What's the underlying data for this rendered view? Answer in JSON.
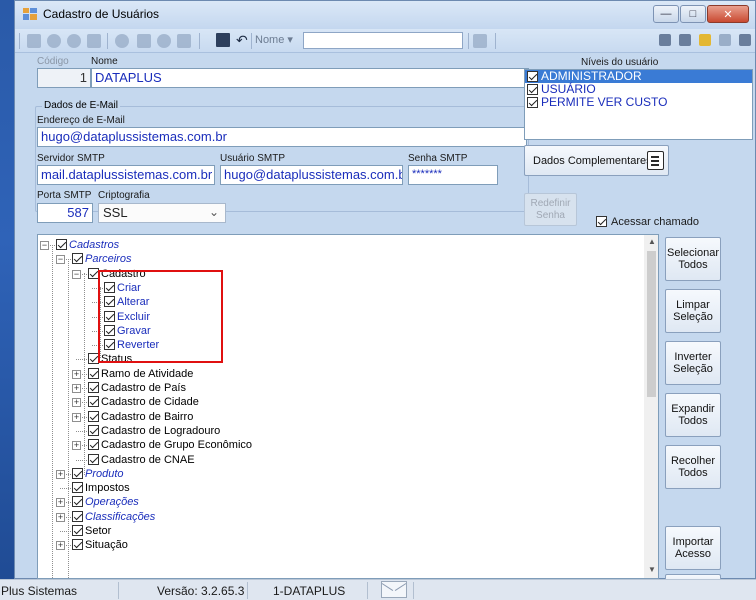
{
  "window": {
    "title": "Cadastro de Usuários",
    "controls": [
      "minimize",
      "maximize",
      "close"
    ]
  },
  "toolbar": {
    "nome_label": "Nome",
    "nome_value": ""
  },
  "form": {
    "codigo_label": "Código",
    "codigo_value": "1",
    "nome_label": "Nome",
    "nome_value": "DATAPLUS",
    "email_group_label": "Dados de E-Mail",
    "email_label": "Endereço de E-Mail",
    "email_value": "hugo@dataplussistemas.com.br",
    "smtp_server_label": "Servidor SMTP",
    "smtp_server_value": "mail.dataplussistemas.com.br",
    "smtp_user_label": "Usuário SMTP",
    "smtp_user_value": "hugo@dataplussistemas.com.br",
    "smtp_password_label": "Senha SMTP",
    "smtp_password_value": "*******",
    "smtp_port_label": "Porta SMTP",
    "smtp_port_value": "587",
    "crypto_label": "Criptografia",
    "crypto_value": "SSL"
  },
  "levels": {
    "label": "Níveis do usuário",
    "items": [
      {
        "label": "ADMINISTRADOR",
        "checked": true,
        "selected": true
      },
      {
        "label": "USUÁRIO",
        "checked": true,
        "selected": false
      },
      {
        "label": "PERMITE VER CUSTO",
        "checked": true,
        "selected": false
      }
    ]
  },
  "buttons": {
    "dados_complementares": "Dados Complementares",
    "redefinir_senha_1": "Redefinir",
    "redefinir_senha_2": "Senha",
    "acessar_chamado": "Acessar chamado",
    "selecionar_todos_1": "Selecionar",
    "selecionar_todos_2": "Todos",
    "limpar_selecao_1": "Limpar",
    "limpar_selecao_2": "Seleção",
    "inverter_selecao_1": "Inverter",
    "inverter_selecao_2": "Seleção",
    "expandir_todos_1": "Expandir",
    "expandir_todos_2": "Todos",
    "recolher_todos_1": "Recolher",
    "recolher_todos_2": "Todos",
    "importar_acesso_1": "Importar",
    "importar_acesso_2": "Acesso"
  },
  "tree": {
    "nodes": [
      {
        "label": "Cadastros",
        "style": "italic",
        "level": 0
      },
      {
        "label": "Parceiros",
        "style": "italic",
        "level": 1
      },
      {
        "label": "Cadastro",
        "style": "normal",
        "level": 2
      },
      {
        "label": "Criar",
        "style": "blue",
        "level": 3
      },
      {
        "label": "Alterar",
        "style": "blue",
        "level": 3
      },
      {
        "label": "Excluir",
        "style": "blue",
        "level": 3
      },
      {
        "label": "Gravar",
        "style": "blue",
        "level": 3
      },
      {
        "label": "Reverter",
        "style": "blue",
        "level": 3
      },
      {
        "label": "Status",
        "style": "normal",
        "level": 2
      },
      {
        "label": "Ramo de Atividade",
        "style": "normal",
        "level": 2
      },
      {
        "label": "Cadastro de País",
        "style": "normal",
        "level": 2
      },
      {
        "label": "Cadastro de Cidade",
        "style": "normal",
        "level": 2
      },
      {
        "label": "Cadastro de Bairro",
        "style": "normal",
        "level": 2
      },
      {
        "label": "Cadastro de Logradouro",
        "style": "normal",
        "level": 2
      },
      {
        "label": "Cadastro de Grupo Econômico",
        "style": "normal",
        "level": 2
      },
      {
        "label": "Cadastro de CNAE",
        "style": "normal",
        "level": 2
      },
      {
        "label": "Produto",
        "style": "italic",
        "level": 1
      },
      {
        "label": "Impostos",
        "style": "normal",
        "level": 1
      },
      {
        "label": "Operações",
        "style": "italic",
        "level": 1
      },
      {
        "label": "Classificações",
        "style": "italic",
        "level": 1
      },
      {
        "label": "Setor",
        "style": "normal",
        "level": 1
      },
      {
        "label": "Situação",
        "style": "normal",
        "level": 1
      }
    ]
  },
  "statusbar": {
    "company": "Plus Sistemas",
    "version": "Versão: 3.2.65.3",
    "tenant": "1-DATAPLUS"
  }
}
